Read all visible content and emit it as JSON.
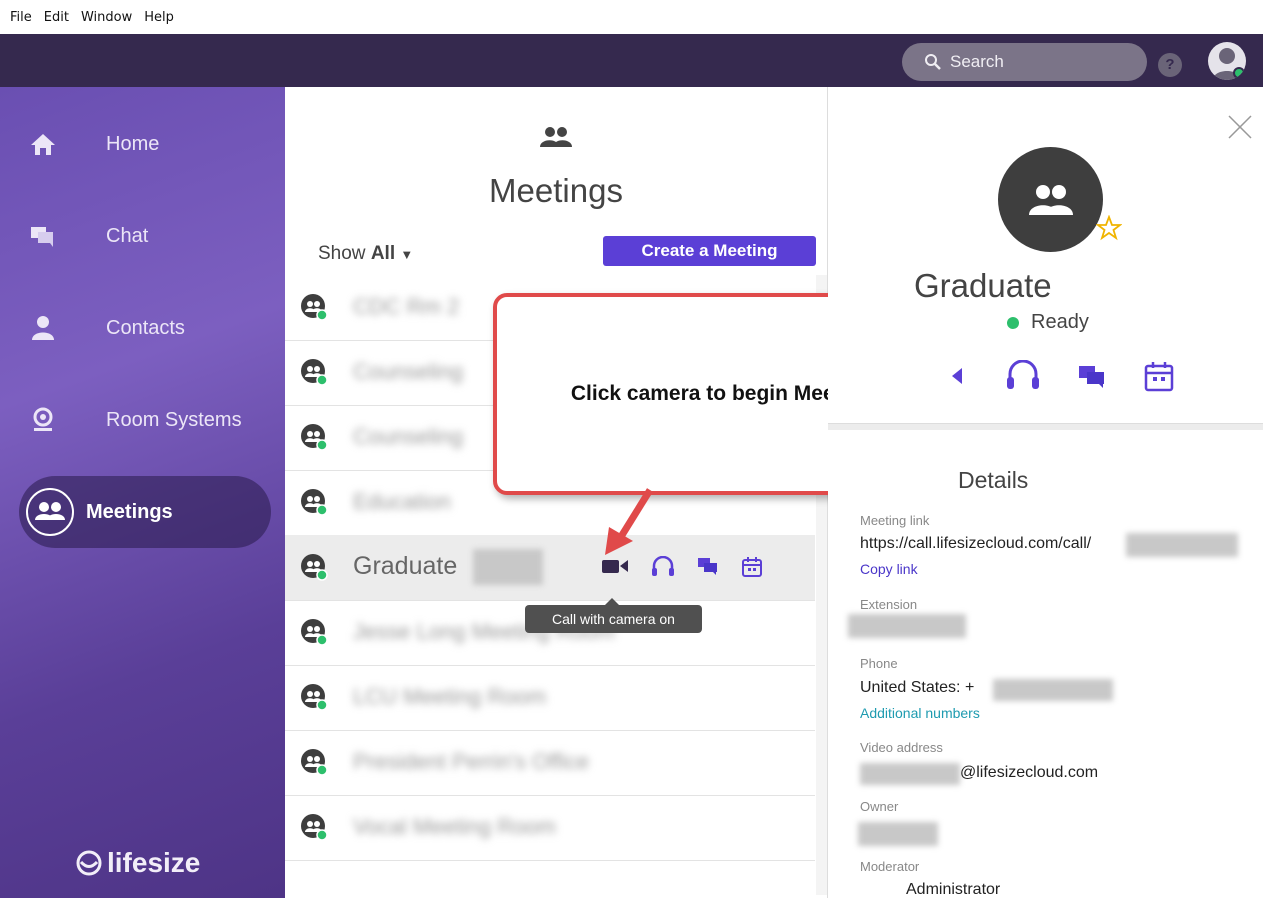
{
  "menubar": {
    "items": [
      "File",
      "Edit",
      "Window",
      "Help"
    ]
  },
  "topbar": {
    "search_placeholder": "Search",
    "help_label": "?"
  },
  "sidebar": {
    "items": [
      {
        "label": "Home",
        "icon": "home-icon"
      },
      {
        "label": "Chat",
        "icon": "chat-icon"
      },
      {
        "label": "Contacts",
        "icon": "person-icon"
      },
      {
        "label": "Room Systems",
        "icon": "webcam-icon"
      },
      {
        "label": "Meetings",
        "icon": "group-icon",
        "active": true
      }
    ],
    "logo": "lifesize"
  },
  "meetings": {
    "title": "Meetings",
    "show_prefix": "Show ",
    "show_value": "All",
    "create_button": "Create a Meeting",
    "rows": [
      {
        "name": "CDC Rm 2"
      },
      {
        "name": "Counseling"
      },
      {
        "name": "Counseling"
      },
      {
        "name": "Education"
      },
      {
        "name": "Graduate",
        "selected": true
      },
      {
        "name": "Jesse Long Meeting Room"
      },
      {
        "name": "LCU Meeting Room"
      },
      {
        "name": "President Perrin's Office"
      },
      {
        "name": "Vocal Meeting Room"
      }
    ],
    "tooltip": "Call with camera on"
  },
  "callout": {
    "text": "Click camera to begin Meeting"
  },
  "details": {
    "title": "Graduate",
    "status": "Ready",
    "section_heading": "Details",
    "meeting_link_label": "Meeting link",
    "meeting_link_value": "https://call.lifesizecloud.com/call/",
    "copy_link": "Copy link",
    "extension_label": "Extension",
    "phone_label": "Phone",
    "phone_value": "United States: +",
    "additional_numbers": "Additional numbers",
    "video_address_label": "Video address",
    "video_address_value": "@lifesizecloud.com",
    "owner_label": "Owner",
    "moderator_label": "Moderator",
    "moderator_value": "Administrator"
  },
  "colors": {
    "accent": "#5b3fd6",
    "topbar": "#35294e",
    "online": "#2dbf6c",
    "callout_border": "#e04a4a"
  }
}
